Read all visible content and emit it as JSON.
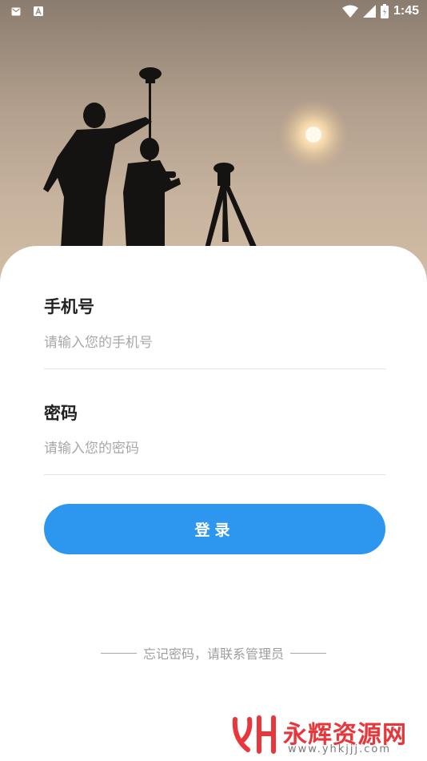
{
  "status_bar": {
    "time": "1:45",
    "left_icons": [
      "mail-icon",
      "a-icon"
    ],
    "right_icons": [
      "wifi-icon",
      "signal-icon",
      "battery-icon"
    ]
  },
  "hero": {
    "image": "surveyors-silhouette-sunset"
  },
  "form": {
    "phone_label": "手机号",
    "phone_placeholder": "请输入您的手机号",
    "phone_value": "",
    "password_label": "密码",
    "password_placeholder": "请输入您的密码",
    "password_value": ""
  },
  "login_button_label": "登录",
  "forgot_text": "忘记密码，请联系管理员",
  "watermark": {
    "name": "永辉资源网",
    "url": "www.yhkjjj.com"
  },
  "colors": {
    "primary": "#2d97ef",
    "watermark": "#e8363b",
    "label": "#222222",
    "placeholder": "#a8a8a8"
  }
}
